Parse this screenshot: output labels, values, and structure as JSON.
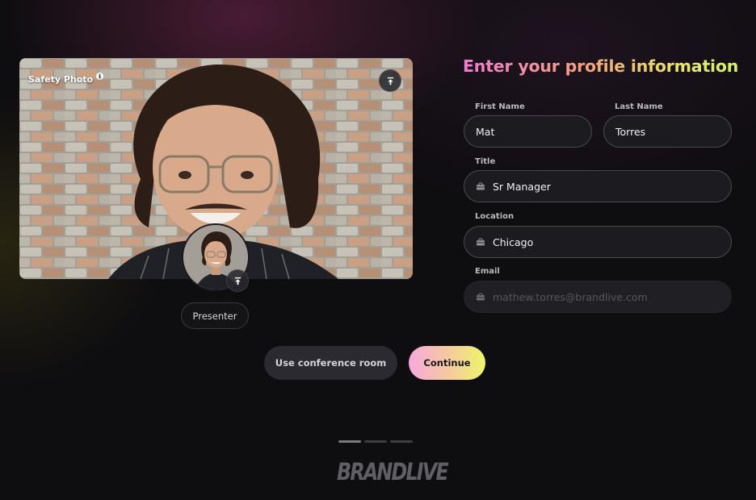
{
  "photo": {
    "safety_label": "Safety Photo",
    "info_icon": "info-icon",
    "upload_icon": "upload-icon"
  },
  "presenter_label": "Presenter",
  "form": {
    "title": "Enter your profile information",
    "first_name": {
      "label": "First Name",
      "value": "Mat"
    },
    "last_name": {
      "label": "Last Name",
      "value": "Torres"
    },
    "title_field": {
      "label": "Title",
      "value": "Sr Manager",
      "icon": "briefcase-icon"
    },
    "location": {
      "label": "Location",
      "value": "Chicago",
      "icon": "briefcase-icon"
    },
    "email": {
      "label": "Email",
      "value": "mathew.torres@brandlive.com",
      "icon": "briefcase-icon",
      "disabled": true
    }
  },
  "actions": {
    "conference_room": "Use conference room",
    "continue": "Continue"
  },
  "steps": {
    "count": 3,
    "active": 1
  },
  "brand": "BRANDLIVE",
  "colors": {
    "background": "#0e0d10",
    "field_bg": "#1b1b20",
    "title_gradient": [
      "#f27bd1",
      "#f4a27a",
      "#d7f06a"
    ],
    "continue_gradient": [
      "#f7a8dd",
      "#eef56a"
    ]
  }
}
